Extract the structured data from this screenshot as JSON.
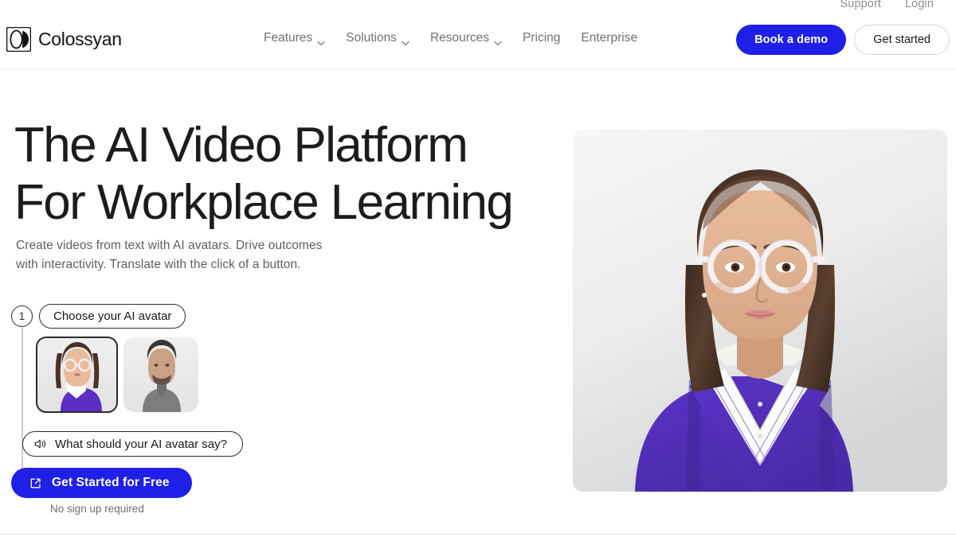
{
  "brand": {
    "name": "Colossyan",
    "logo_icon": "colossyan-lens-logo",
    "accent_color": "#1f1fe8",
    "text_color": "#1b1c1f"
  },
  "utility_bar": {
    "links": [
      {
        "label": "Support",
        "name": "support-link"
      },
      {
        "label": "Login",
        "name": "login-link"
      }
    ]
  },
  "header": {
    "nav": [
      {
        "label": "Features",
        "has_dropdown": true
      },
      {
        "label": "Solutions",
        "has_dropdown": true
      },
      {
        "label": "Resources",
        "has_dropdown": true
      },
      {
        "label": "Pricing",
        "has_dropdown": false
      },
      {
        "label": "Enterprise",
        "has_dropdown": false
      }
    ],
    "actions": {
      "primary_label": "Book a demo",
      "secondary_label": "Get started"
    }
  },
  "hero": {
    "title": "The AI Video Platform\nFor Workplace Learning",
    "subtitle": "Create videos from text with AI avatars. Drive outcomes\nwith interactivity. Translate with the click of a button.",
    "image_alt": "AI avatar woman with white glasses in purple v-neck sweater"
  },
  "widget": {
    "step_number": "1",
    "step_label": "Choose your AI avatar",
    "avatars": [
      {
        "name": "avatar-option-female",
        "selected": true
      },
      {
        "name": "avatar-option-male",
        "selected": false
      }
    ],
    "say_prompt": "What should your AI avatar say?",
    "say_icon": "speaker-icon",
    "cta_label": "Get Started for Free",
    "cta_icon": "external-link-icon",
    "footnote": "No sign up required"
  }
}
